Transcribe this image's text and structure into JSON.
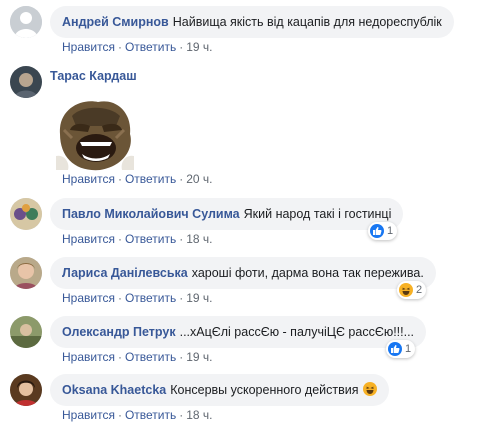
{
  "comments": [
    {
      "author": "Андрей Смирнов",
      "text": "Найвища якість від кацапів для недореспублік",
      "like": "Нравится",
      "reply": "Ответить",
      "time": "19 ч."
    },
    {
      "author": "Тарас Кардаш",
      "text": "",
      "sticker": "angry-warrior-sticker",
      "like": "Нравится",
      "reply": "Ответить",
      "time": "20 ч."
    },
    {
      "author": "Павло Миколайович Сулима",
      "text": "Який народ такі і гостинці",
      "like": "Нравится",
      "reply": "Ответить",
      "time": "18 ч.",
      "reaction_icon": "like-icon",
      "reaction_count": "1"
    },
    {
      "author": "Лариса Данілевська",
      "text": "хароші фоти, дарма вона так пережива.",
      "like": "Нравится",
      "reply": "Ответить",
      "time": "19 ч.",
      "reaction_icon": "haha-icon",
      "reaction_count": "2"
    },
    {
      "author": "Олександр Петрук",
      "text": "...хАцЄлі рассЄю - палучіЦЄ рассЄю!!!...",
      "like": "Нравится",
      "reply": "Ответить",
      "time": "19 ч.",
      "reaction_icon": "like-icon",
      "reaction_count": "1"
    },
    {
      "author": "Oksana Khaetcka",
      "text": "Консервы ускоренного действия",
      "emoji": "laughing-emoji",
      "like": "Нравится",
      "reply": "Ответить",
      "time": "18 ч."
    }
  ],
  "colors": {
    "link": "#385898",
    "bubble": "#f2f3f5",
    "meta": "#606770",
    "like_blue": "#1877f2",
    "haha_yellow": "#f7b125"
  }
}
